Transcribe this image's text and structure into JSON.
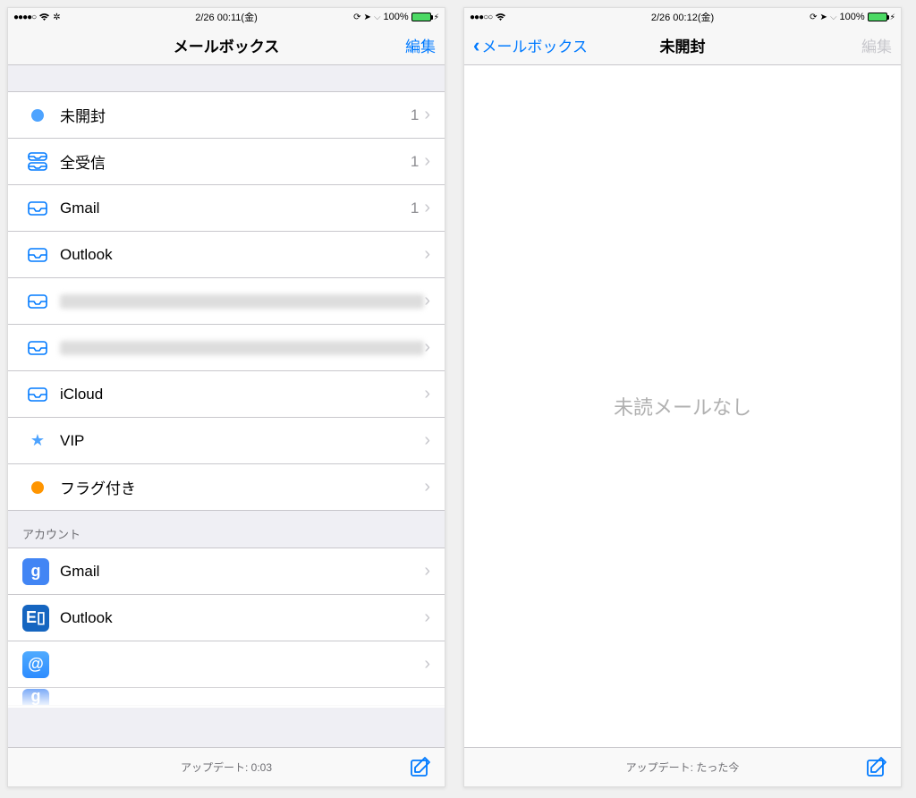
{
  "left": {
    "status": {
      "time": "2/26 00:11(金)",
      "battery": "100%"
    },
    "nav": {
      "title": "メールボックス",
      "edit": "編集"
    },
    "mailboxes": [
      {
        "icon": "unread-dot-icon",
        "label": "未開封",
        "count": "1"
      },
      {
        "icon": "all-inboxes-icon",
        "label": "全受信",
        "count": "1"
      },
      {
        "icon": "inbox-icon",
        "label": "Gmail",
        "count": "1"
      },
      {
        "icon": "inbox-icon",
        "label": "Outlook",
        "count": ""
      },
      {
        "icon": "inbox-icon",
        "label": "",
        "count": "",
        "blurred": true
      },
      {
        "icon": "inbox-icon",
        "label": "",
        "count": "",
        "blurred": true
      },
      {
        "icon": "inbox-icon",
        "label": "iCloud",
        "count": ""
      },
      {
        "icon": "vip-star-icon",
        "label": "VIP",
        "count": ""
      },
      {
        "icon": "flagged-dot-icon",
        "label": "フラグ付き",
        "count": ""
      }
    ],
    "accounts_header": "アカウント",
    "accounts": [
      {
        "icon": "google-app-icon",
        "label": "Gmail"
      },
      {
        "icon": "exchange-app-icon",
        "label": "Outlook"
      },
      {
        "icon": "at-app-icon",
        "label": "",
        "blurred": true
      },
      {
        "icon": "google-app-icon",
        "label": ""
      }
    ],
    "toolbar": {
      "status": "アップデート: 0:03"
    }
  },
  "right": {
    "status": {
      "time": "2/26 00:12(金)",
      "battery": "100%"
    },
    "nav": {
      "back": "メールボックス",
      "title": "未開封",
      "edit": "編集"
    },
    "empty": "未読メールなし",
    "toolbar": {
      "status": "アップデート: たった今"
    }
  },
  "colors": {
    "tint": "#007aff",
    "battery_green": "#4cd964"
  }
}
